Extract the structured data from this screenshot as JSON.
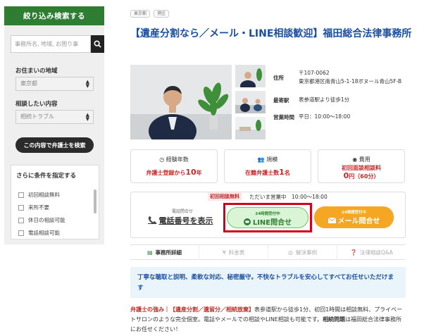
{
  "sidebar": {
    "header": "絞り込み検索する",
    "search_placeholder": "事務所名, 地域, お困り事",
    "area_label": "お住まいの地域",
    "area_value": "東京都",
    "consult_label": "相談したい内容",
    "consult_value": "相続トラブル",
    "search_button": "この内容で弁護士を検索",
    "conditions_title": "さらに条件を指定する",
    "conditions": [
      "初回相談無料",
      "来所不要",
      "休日の相談可能",
      "電話相談可能"
    ]
  },
  "tags": [
    "東京都",
    "港区"
  ],
  "office": {
    "title": "【遺産分割なら／メール・LINE相談歓迎】福田総合法律事務所",
    "address_label": "住所",
    "postal": "〒107-0062",
    "address": "東京都港区南青山5-1-18ボヌール青山5F-B",
    "station_label": "最寄駅",
    "station": "表参道駅より徒歩1分",
    "hours_label": "営業時間",
    "hours": "平日：10:00〜18:00"
  },
  "stats": [
    {
      "title": "経験年数",
      "pre": "弁護士登録から",
      "num": "10",
      "post": "年"
    },
    {
      "title": "規模",
      "pre": "在籍弁護士数",
      "num": "1",
      "post": "名"
    },
    {
      "title": "費用",
      "pre": "初回面談相談料",
      "num": "0",
      "post": "円（60分）"
    }
  ],
  "contact": {
    "badge": "初回相談無料",
    "open": "ただいま営業中　10:00〜18:00",
    "phone_sub": "電話問合せ",
    "phone_label": "電話番号を表示",
    "line_sub": "24時間受付中",
    "line_label": "LINE問合せ",
    "mail_sub": "24時間受付中",
    "mail_label": "メール問合せ"
  },
  "tabs": [
    {
      "icon": "▤",
      "label": "事務所詳細"
    },
    {
      "icon": "¥",
      "label": "料金表"
    },
    {
      "icon": "◎",
      "label": "解決事例"
    },
    {
      "icon": "❓",
      "label": "法律相談Q&A"
    }
  ],
  "highlight": "丁寧な聴取と説明、柔軟な対応、秘密厳守。不快なトラブルを安心してすべてお任せいただけます",
  "desc": {
    "lead": "弁護士の強み｜",
    "tags": "【遺産分割／遺留分／相続放棄】",
    "body1": "表参道駅から徒歩1分、初回1時間は相談無料、プライベートサロンのような完全個室。電話やメールでの相談やLINE相談も可能です。",
    "bold": "相続問題",
    "body2": "は福田総合法律事務所にお任せください！"
  },
  "colors": {
    "green": "#2e7d32",
    "blue": "#1a4fa0",
    "red": "#c62828",
    "orange": "#f5a623",
    "line_green": "#69c96a"
  }
}
